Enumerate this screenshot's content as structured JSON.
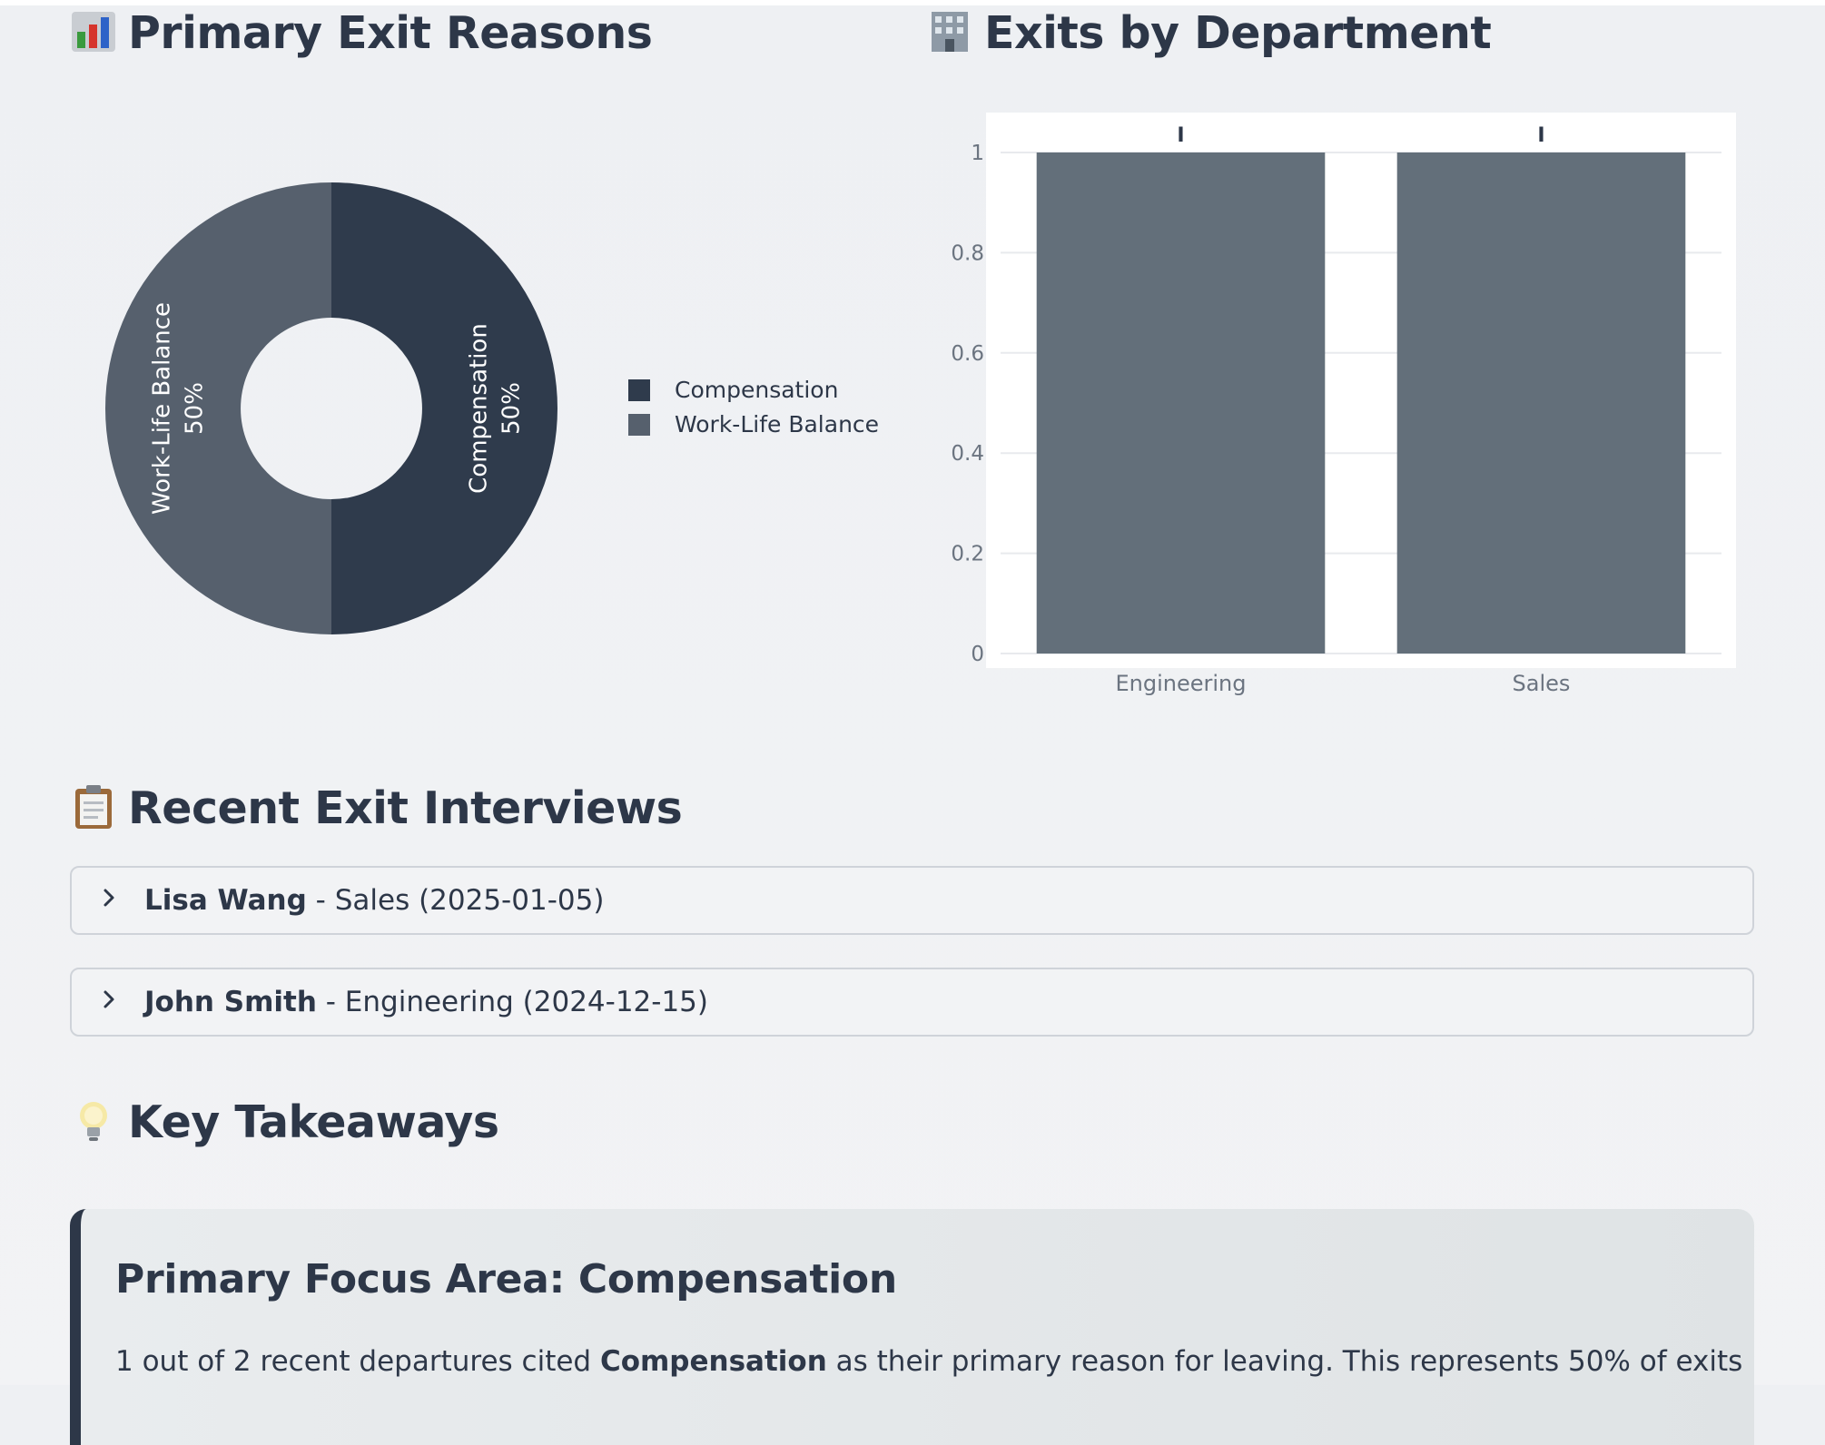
{
  "sections": {
    "exit_reasons_title": "Primary Exit Reasons",
    "department_title": "Exits by Department",
    "interviews_title": "Recent Exit Interviews",
    "takeaways_title": "Key Takeaways"
  },
  "icons": {
    "exit_reasons": "bar-chart-icon",
    "department": "office-building-icon",
    "interviews": "clipboard-icon",
    "takeaways": "light-bulb-icon",
    "expand": "chevron-right-icon"
  },
  "colors": {
    "compensation": "#2f3b4c",
    "work_life_balance": "#56606d",
    "bar": "#636f7a"
  },
  "chart_data": [
    {
      "type": "pie",
      "hole": true,
      "labels": [
        "Compensation",
        "Work-Life Balance"
      ],
      "values": [
        1,
        1
      ],
      "percent_labels": [
        "50%",
        "50%"
      ],
      "legend": [
        "Compensation",
        "Work-Life Balance"
      ],
      "legend_position": "right"
    },
    {
      "type": "bar",
      "categories": [
        "Engineering",
        "Sales"
      ],
      "values": [
        1,
        1
      ],
      "ylim": [
        0,
        1
      ],
      "yticks": [
        "0",
        "0.2",
        "0.4",
        "0.6",
        "0.8",
        "1"
      ],
      "grid": true,
      "data_labels": [
        "I",
        "I"
      ]
    }
  ],
  "interviews": [
    {
      "name": "Lisa Wang",
      "detail": " - Sales (2025-01-05)"
    },
    {
      "name": "John Smith",
      "detail": " - Engineering (2024-12-15)"
    }
  ],
  "takeaway": {
    "heading": "Primary Focus Area: Compensation",
    "text_before": "1 out of 2 recent departures cited ",
    "text_bold": "Compensation",
    "text_after": " as their primary reason for leaving. This represents 50% of exits"
  }
}
